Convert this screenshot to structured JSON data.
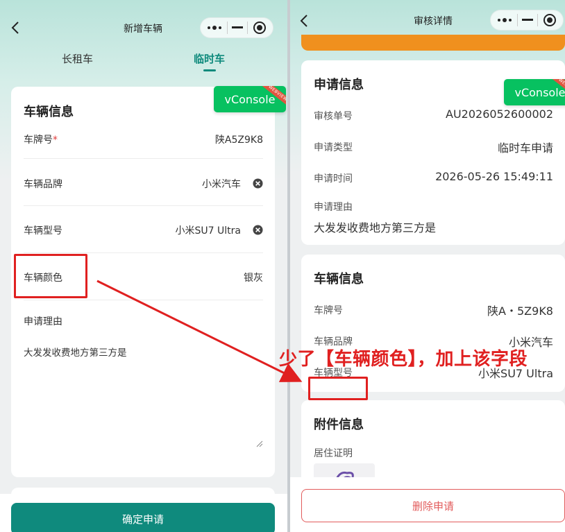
{
  "left": {
    "nav_title": "新增车辆",
    "tabs": [
      {
        "label": "长租车",
        "active": false
      },
      {
        "label": "临时车",
        "active": true
      }
    ],
    "card_title": "车辆信息",
    "fields": {
      "plate": {
        "label": "车牌号",
        "required_mark": "*",
        "value": "陕A5Z9K8"
      },
      "brand": {
        "label": "车辆品牌",
        "value": "小米汽车"
      },
      "model": {
        "label": "车辆型号",
        "value": "小米SU7 Ultra"
      },
      "color": {
        "label": "车辆颜色",
        "value": "银灰"
      },
      "reason": {
        "label": "申请理由",
        "value": "大发发收费地方第三方是"
      }
    },
    "confirm_button": "确定申请"
  },
  "right": {
    "nav_title": "审核详情",
    "apply_card": {
      "title": "申请信息",
      "rows": [
        {
          "label": "审核单号",
          "value": "AU2026052600002"
        },
        {
          "label": "申请类型",
          "value": "临时车申请"
        },
        {
          "label": "申请时间",
          "value": "2026-05-26 15:49:11"
        }
      ],
      "reason_label": "申请理由",
      "reason_value": "大发发收费地方第三方是"
    },
    "vehicle_card": {
      "title": "车辆信息",
      "rows": [
        {
          "label": "车牌号",
          "value": "陕A・5Z9K8"
        },
        {
          "label": "车辆品牌",
          "value": "小米汽车"
        },
        {
          "label": "车辆型号",
          "value": "小米SU7 Ultra"
        }
      ]
    },
    "attach_card": {
      "title": "附件信息",
      "item_label": "居住证明"
    },
    "delete_button": "删除申请"
  },
  "vconsole": {
    "label": "vConsole",
    "ribbon": "WEBVIEW",
    "color": "#07c160"
  },
  "annotation": {
    "text": "少了【车辆颜色】，加上该字段",
    "color": "#e02020"
  },
  "colors": {
    "accent": "#0e8a7c",
    "danger": "#e25b5b",
    "banner": "#f0901e"
  }
}
